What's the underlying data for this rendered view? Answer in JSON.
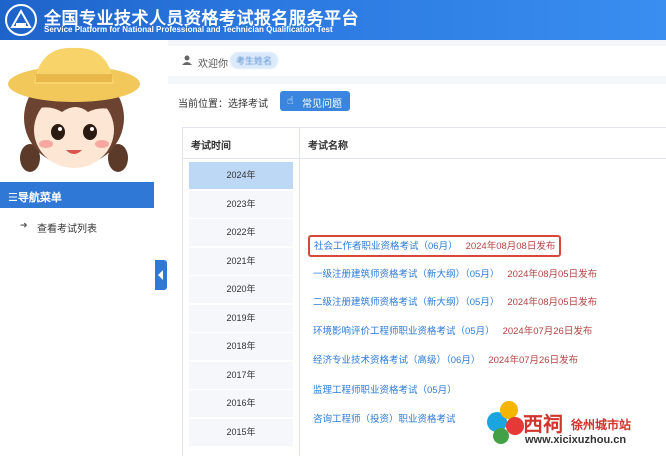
{
  "header": {
    "title_cn": "全国专业技术人员资格考试报名服务平台",
    "title_en": "Service Platform for National Professional and Technician Qualification Test"
  },
  "sidebar": {
    "nav_title": "☰导航菜单",
    "items": [
      {
        "label": "查看考试列表"
      }
    ]
  },
  "welcome": {
    "label": "欢迎你",
    "username": "考生姓名"
  },
  "breadcrumb": "当前位置：选择考试",
  "faq_button": "常见问题",
  "table": {
    "col_time": "考试时间",
    "col_name": "考试名称",
    "years": [
      "2024年",
      "2023年",
      "2022年",
      "2021年",
      "2020年",
      "2019年",
      "2018年",
      "2017年",
      "2016年",
      "2015年"
    ],
    "active_year": "2024年",
    "exams": [
      {
        "name": "社会工作者职业资格考试（06月）",
        "date": "2024年08月08日发布"
      },
      {
        "name": "一级注册建筑师资格考试（新大纲）（05月）",
        "date": "2024年08月05日发布"
      },
      {
        "name": "二级注册建筑师资格考试（新大纲）（05月）",
        "date": "2024年08月05日发布"
      },
      {
        "name": "环境影响评价工程师职业资格考试（05月）",
        "date": "2024年07月26日发布"
      },
      {
        "name": "经济专业技术资格考试（高级）（06月）",
        "date": "2024年07月26日发布"
      },
      {
        "name": "监理工程师职业资格考试（05月）",
        "date": ""
      },
      {
        "name": "咨询工程师（投资）职业资格考试",
        "date": ""
      }
    ]
  },
  "watermark": {
    "brand": "西祠",
    "city": "徐州城市站",
    "url": "www.xicixuzhou.cn"
  },
  "colors": {
    "header": "#2a78e0",
    "link": "#2c7bd8",
    "date": "#b34242",
    "highlight": "#d9473b"
  }
}
